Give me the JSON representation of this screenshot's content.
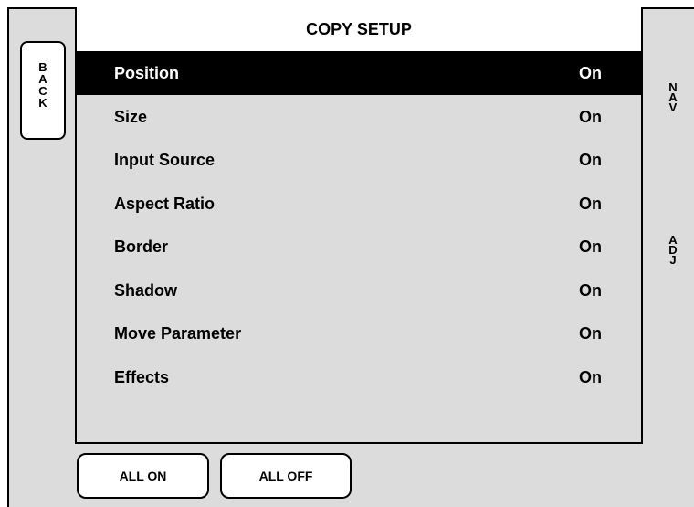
{
  "title": "COPY SETUP",
  "back": [
    "B",
    "A",
    "C",
    "K"
  ],
  "nav": [
    "N",
    "A",
    "V"
  ],
  "adj": [
    "A",
    "D",
    "J"
  ],
  "rows": [
    {
      "label": "Position",
      "value": "On",
      "selected": true
    },
    {
      "label": "Size",
      "value": "On",
      "selected": false
    },
    {
      "label": "Input Source",
      "value": "On",
      "selected": false
    },
    {
      "label": "Aspect Ratio",
      "value": "On",
      "selected": false
    },
    {
      "label": "Border",
      "value": "On",
      "selected": false
    },
    {
      "label": "Shadow",
      "value": "On",
      "selected": false
    },
    {
      "label": "Move Parameter",
      "value": "On",
      "selected": false
    },
    {
      "label": "Effects",
      "value": "On",
      "selected": false
    }
  ],
  "buttons": {
    "all_on": "ALL ON",
    "all_off": "ALL OFF"
  }
}
